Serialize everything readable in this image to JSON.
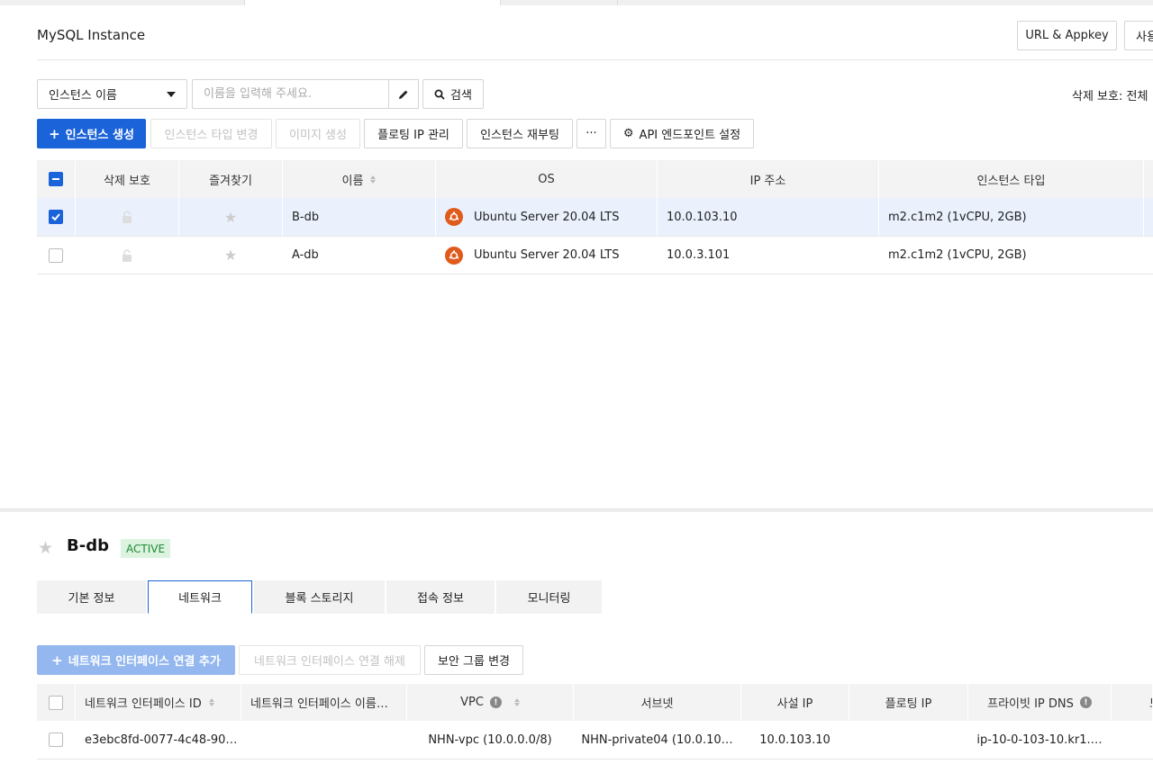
{
  "header": {
    "title": "MySQL Instance",
    "url_appkey_label": "URL & Appkey",
    "user_label_partial": "사용"
  },
  "search": {
    "field_select": "인스턴스 이름",
    "placeholder": "이름을 입력해 주세요.",
    "search_label": "검색",
    "delete_protect_filter": "삭제 보호: 전체"
  },
  "toolbar": {
    "create": "인스턴스 생성",
    "change_type": "인스턴스 타입 변경",
    "create_image": "이미지 생성",
    "floating_ip": "플로팅 IP 관리",
    "reboot": "인스턴스 재부팅",
    "more": "···",
    "api_endpoint": "API 엔드포인트 설정"
  },
  "instance_table": {
    "columns": [
      "삭제 보호",
      "즐겨찾기",
      "이름",
      "OS",
      "IP 주소",
      "인스턴스 타입"
    ],
    "rows": [
      {
        "selected": true,
        "name": "B-db",
        "os": "Ubuntu Server 20.04 LTS",
        "ip": "10.0.103.10",
        "type": "m2.c1m2 (1vCPU, 2GB)"
      },
      {
        "selected": false,
        "name": "A-db",
        "os": "Ubuntu Server 20.04 LTS",
        "ip": "10.0.3.101",
        "type": "m2.c1m2 (1vCPU, 2GB)"
      }
    ]
  },
  "detail": {
    "name": "B-db",
    "status": "ACTIVE",
    "tabs": [
      "기본 정보",
      "네트워크",
      "블록 스토리지",
      "접속 정보",
      "모니터링"
    ],
    "active_tab": 1
  },
  "network": {
    "add_interface": "네트워크 인터페이스 연결 추가",
    "remove_interface": "네트워크 인터페이스 연결 해제",
    "change_sg": "보안 그룹 변경",
    "columns": [
      "네트워크 인터페이스 ID",
      "네트워크 인터페이스 이름…",
      "VPC",
      "서브넷",
      "사설 IP",
      "플로팅 IP",
      "프라이빗 IP DNS",
      "보"
    ],
    "rows": [
      {
        "id": "e3ebc8fd-0077-4c48-90…",
        "name": "",
        "vpc": "NHN-vpc (10.0.0.0/8)",
        "subnet": "NHN-private04 (10.0.10…",
        "private_ip": "10.0.103.10",
        "floating_ip": "",
        "dns": "ip-10-0-103-10.kr1.…"
      }
    ]
  },
  "colors": {
    "primary": "#1b63d8",
    "ubuntu": "#e05a1c",
    "active_badge_bg": "#dbf3df",
    "active_badge_text": "#1f8a35"
  }
}
